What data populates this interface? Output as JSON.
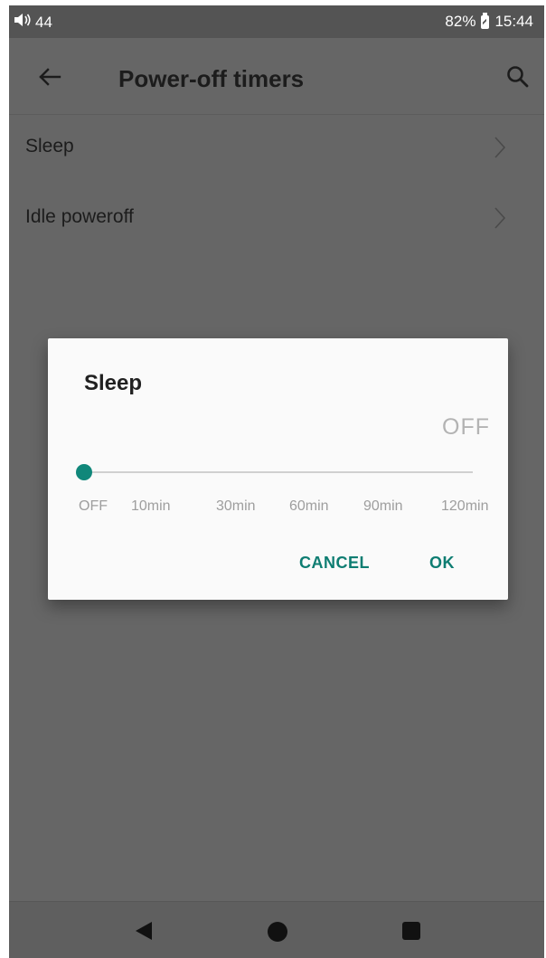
{
  "status_bar": {
    "volume_level": "44",
    "battery_percent": "82%",
    "time": "15:44"
  },
  "app_bar": {
    "title": "Power-off timers",
    "back_icon": "arrow-left-icon",
    "search_icon": "search-icon"
  },
  "list": {
    "items": [
      {
        "label": "Sleep"
      },
      {
        "label": "Idle poweroff"
      }
    ]
  },
  "dialog": {
    "title": "Sleep",
    "current_value": "OFF",
    "slider_options": [
      "OFF",
      "10min",
      "30min",
      "60min",
      "90min",
      "120min"
    ],
    "selected_index": 0,
    "cancel_label": "CANCEL",
    "ok_label": "OK",
    "accent_color": "#10877a"
  },
  "nav_bar": {
    "back_icon": "triangle-back-icon",
    "home_icon": "circle-home-icon",
    "recents_icon": "square-recents-icon"
  }
}
